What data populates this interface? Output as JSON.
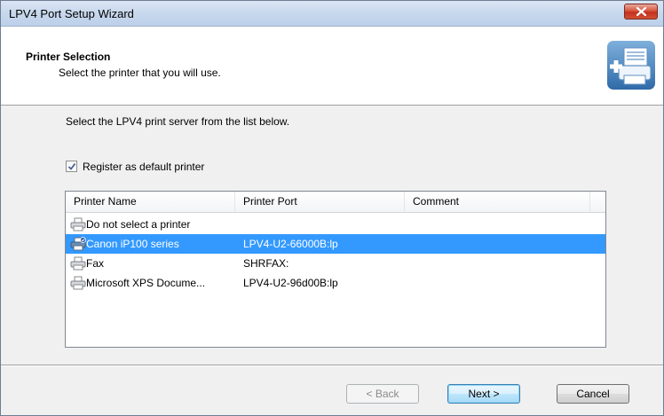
{
  "window": {
    "title": "LPV4 Port Setup Wizard"
  },
  "header": {
    "title": "Printer Selection",
    "subtitle": "Select the printer that you will use."
  },
  "content": {
    "instruction": "Select the LPV4 print server from the list below.",
    "default_checkbox": {
      "label": "Register as default printer",
      "checked": true
    }
  },
  "listview": {
    "columns": [
      "Printer Name",
      "Printer Port",
      "Comment"
    ],
    "rows": [
      {
        "name": "Do not select a printer",
        "port": "",
        "comment": "",
        "selected": false
      },
      {
        "name": "Canon iP100 series",
        "port": "LPV4-U2-66000B:lp",
        "comment": "",
        "selected": true
      },
      {
        "name": "Fax",
        "port": "SHRFAX:",
        "comment": "",
        "selected": false
      },
      {
        "name": "Microsoft XPS Docume...",
        "port": "LPV4-U2-96d00B:lp",
        "comment": "",
        "selected": false
      }
    ],
    "selection_color": "#3399ff"
  },
  "buttons": {
    "back": "< Back",
    "next": "Next >",
    "cancel": "Cancel"
  },
  "icons": {
    "close": "close-icon",
    "wizard": "printer-add-icon",
    "printer": "printer-icon"
  }
}
